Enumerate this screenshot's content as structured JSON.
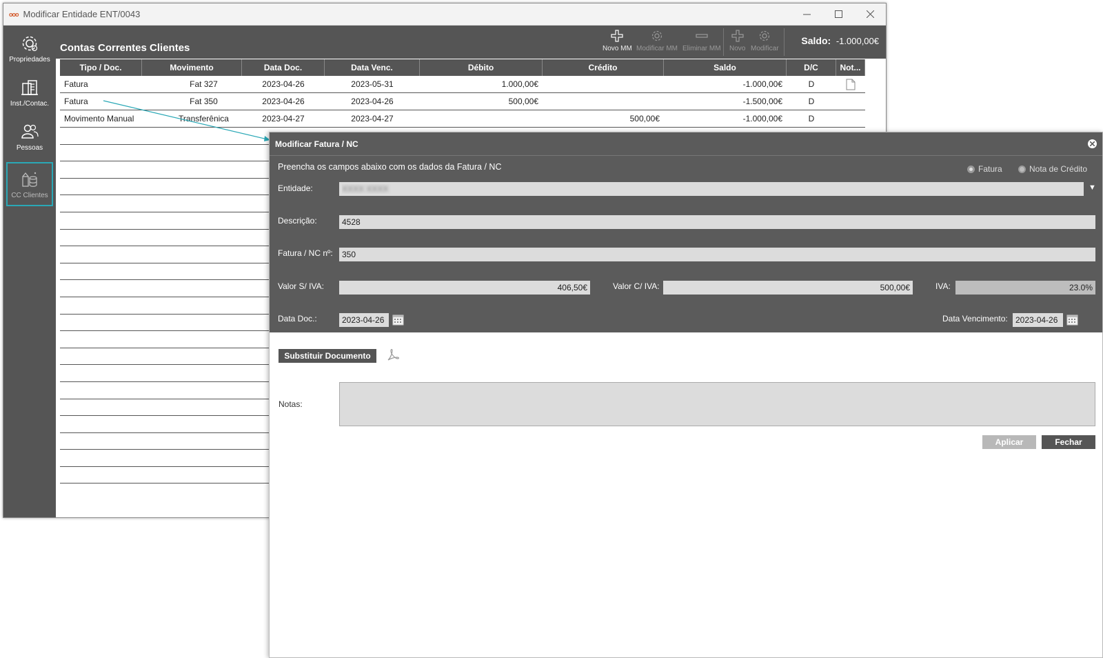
{
  "window": {
    "title": "Modificar Entidade ENT/0043",
    "logo_text": "ooo"
  },
  "sidebar": {
    "items": [
      {
        "label": "Propriedades",
        "icon": "gear-icon"
      },
      {
        "label": "Inst./Contac.",
        "icon": "building-icon"
      },
      {
        "label": "Pessoas",
        "icon": "people-icon"
      },
      {
        "label": "CC Clientes",
        "icon": "accounts-icon",
        "active": true
      }
    ]
  },
  "toolbar": {
    "section_title": "Contas Correntes Clientes",
    "buttons": [
      {
        "label": "Novo MM",
        "enabled": true
      },
      {
        "label": "Modificar MM",
        "enabled": false
      },
      {
        "label": "Eliminar MM",
        "enabled": false
      },
      {
        "label": "Novo",
        "enabled": false
      },
      {
        "label": "Modificar",
        "enabled": false
      }
    ],
    "saldo_label": "Saldo:",
    "saldo_value": "-1.000,00€"
  },
  "grid": {
    "columns": [
      "Tipo / Doc.",
      "Movimento",
      "Data Doc.",
      "Data Venc.",
      "Débito",
      "Crédito",
      "Saldo",
      "D/C",
      "Not..."
    ],
    "rows": [
      [
        "Fatura",
        "Fat 327",
        "2023-04-26",
        "2023-05-31",
        "1.000,00€",
        "",
        "-1.000,00€",
        "D",
        ""
      ],
      [
        "Fatura",
        "Fat 350",
        "2023-04-26",
        "2023-04-26",
        "500,00€",
        "",
        "-1.500,00€",
        "D",
        ""
      ],
      [
        "Movimento Manual",
        "Transferênica",
        "2023-04-27",
        "2023-04-27",
        "",
        "500,00€",
        "-1.000,00€",
        "D",
        ""
      ]
    ]
  },
  "dialog": {
    "title": "Modificar Fatura / NC",
    "subtitle": "Preencha os campos abaixo com os dados da Fatura / NC",
    "radio_fatura": "Fatura",
    "radio_nota": "Nota de Crédito",
    "entidade_label": "Entidade:",
    "entidade_value": "XXXX XXXX",
    "descricao_label": "Descrição:",
    "descricao_value": "4528",
    "fatura_label": "Fatura / NC nº:",
    "fatura_value": "350",
    "valor_s_label": "Valor S/ IVA:",
    "valor_s_value": "406,50€",
    "valor_c_label": "Valor C/ IVA:",
    "valor_c_value": "500,00€",
    "iva_label": "IVA:",
    "iva_value": "23.0%",
    "data_doc_label": "Data Doc.:",
    "data_doc_value": "2023-04-26",
    "data_venc_label": "Data Vencimento:",
    "data_venc_value": "2023-04-26",
    "substituir_label": "Substituir Documento",
    "notas_label": "Notas:",
    "aplicar_label": "Aplicar",
    "fechar_label": "Fechar"
  }
}
